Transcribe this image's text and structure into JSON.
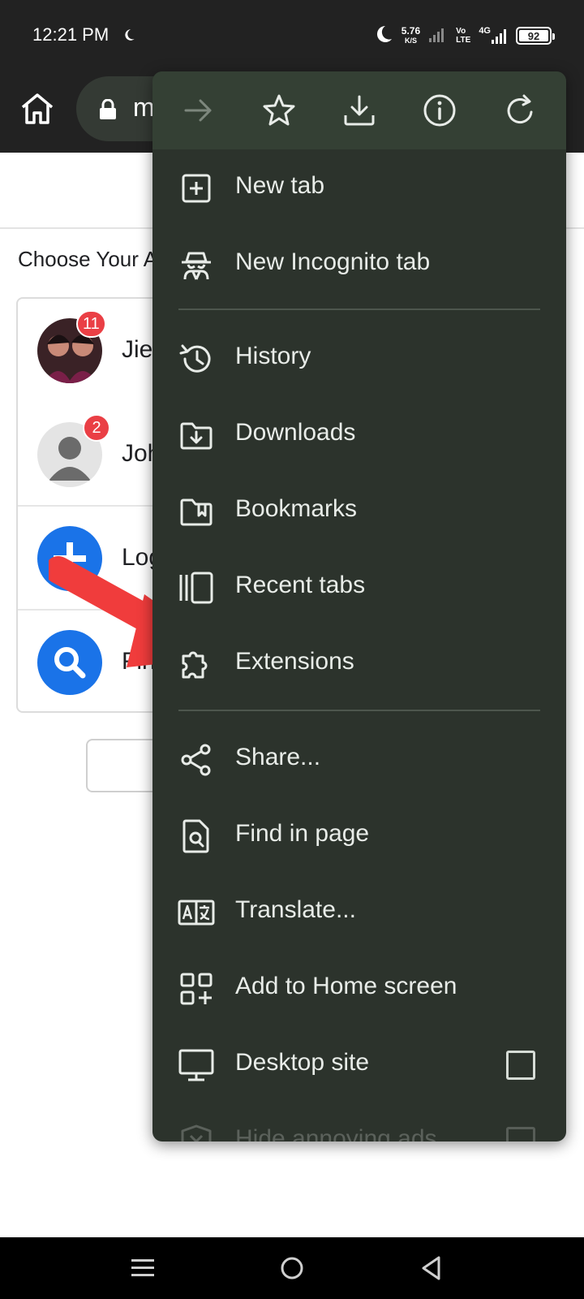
{
  "status_bar": {
    "time": "12:21 PM",
    "net_speed_value": "5.76",
    "net_speed_unit": "K/S",
    "volte_top": "Vo",
    "volte_bottom": "LTE",
    "network_type": "4G",
    "battery_level": "92"
  },
  "toolbar": {
    "url_visible": "m"
  },
  "page": {
    "heading": "Choose Your A",
    "accounts": [
      {
        "name_visible": "Jie",
        "badge": "11"
      },
      {
        "name_visible": "Joh",
        "badge": "2"
      },
      {
        "name_visible": "Log"
      },
      {
        "name_visible": "Fin"
      }
    ]
  },
  "menu": {
    "items": [
      {
        "label": "New tab",
        "icon": "new-tab-icon"
      },
      {
        "label": "New Incognito tab",
        "icon": "incognito-icon"
      },
      {
        "label": "History",
        "icon": "history-icon"
      },
      {
        "label": "Downloads",
        "icon": "downloads-icon"
      },
      {
        "label": "Bookmarks",
        "icon": "bookmarks-icon"
      },
      {
        "label": "Recent tabs",
        "icon": "recent-tabs-icon"
      },
      {
        "label": "Extensions",
        "icon": "puzzle-icon"
      },
      {
        "label": "Share...",
        "icon": "share-icon"
      },
      {
        "label": "Find in page",
        "icon": "find-in-page-icon"
      },
      {
        "label": "Translate...",
        "icon": "translate-icon"
      },
      {
        "label": "Add to Home screen",
        "icon": "add-to-home-icon"
      },
      {
        "label": "Desktop site",
        "icon": "desktop-icon",
        "checked": false
      },
      {
        "label": "Hide annoying ads",
        "icon": "shield-icon",
        "checked": false
      }
    ]
  },
  "colors": {
    "menu_bg": "#2c332c",
    "menu_header_bg": "#344034",
    "arrow": "#f03c3c",
    "badge": "#ea3f45",
    "accent_blue": "#1a73e8"
  }
}
